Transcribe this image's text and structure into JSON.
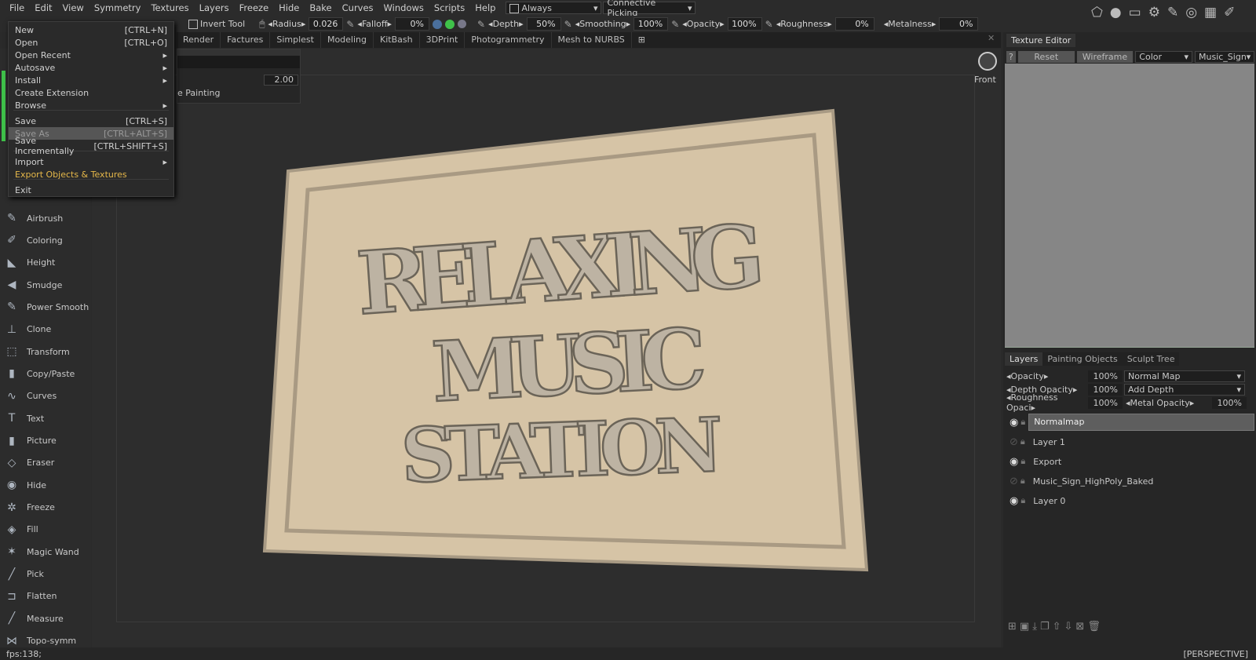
{
  "menubar": {
    "items": [
      "File",
      "Edit",
      "View",
      "Symmetry",
      "Textures",
      "Layers",
      "Freeze",
      "Hide",
      "Bake",
      "Curves",
      "Windows",
      "Scripts",
      "Help"
    ],
    "always": "Always",
    "picking": "Connective Picking"
  },
  "toolbar": {
    "invert_tool": "Invert Tool",
    "radius_label": "Radius",
    "radius": "0.026",
    "falloff_label": "Falloff",
    "falloff": "0%",
    "depth_label": "Depth",
    "depth": "50%",
    "smoothing_label": "Smoothing",
    "smoothing": "100%",
    "opacity_label": "Opacity",
    "opacity": "100%",
    "roughness_label": "Roughness",
    "roughness": "0%",
    "metalness_label": "Metalness",
    "metalness": "0%"
  },
  "tabs": [
    "Render",
    "Factures",
    "Simplest",
    "Modeling",
    "KitBash",
    "3DPrint",
    "Photogrammetry",
    "Mesh to NURBS"
  ],
  "file_menu": [
    {
      "label": "New",
      "shortcut": "[CTRL+N]"
    },
    {
      "label": "Open",
      "shortcut": "[CTRL+O]"
    },
    {
      "label": "Open Recent",
      "shortcut": "▸"
    },
    {
      "label": "Autosave",
      "shortcut": "▸"
    },
    {
      "label": "Install",
      "shortcut": "▸"
    },
    {
      "label": "Create Extension",
      "shortcut": ""
    },
    {
      "label": "Browse",
      "shortcut": "▸"
    },
    {
      "label": "Save",
      "shortcut": "[CTRL+S]"
    },
    {
      "label": "Save As",
      "shortcut": "[CTRL+ALT+S]"
    },
    {
      "label": "Save Incrementally",
      "shortcut": "[CTRL+SHIFT+S]"
    },
    {
      "label": "Import",
      "shortcut": "▸"
    },
    {
      "label": "Export Objects & Textures",
      "shortcut": ""
    },
    {
      "label": "Exit",
      "shortcut": ""
    }
  ],
  "tool_options": {
    "value": "2.00",
    "painting": "e Painting"
  },
  "tools": [
    {
      "label": "Airbrush",
      "icon": "airbrush-icon",
      "g": "✎"
    },
    {
      "label": "Coloring",
      "icon": "coloring-icon",
      "g": "✐"
    },
    {
      "label": "Height",
      "icon": "height-icon",
      "g": "◣"
    },
    {
      "label": "Smudge",
      "icon": "smudge-icon",
      "g": "◀"
    },
    {
      "label": "Power Smooth",
      "icon": "power-smooth-icon",
      "g": "✎"
    },
    {
      "label": "Clone",
      "icon": "clone-icon",
      "g": "⊥"
    },
    {
      "label": "Transform",
      "icon": "transform-icon",
      "g": "⬚"
    },
    {
      "label": "Copy/Paste",
      "icon": "copy-paste-icon",
      "g": "▮"
    },
    {
      "label": "Curves",
      "icon": "curves-icon",
      "g": "∿"
    },
    {
      "label": "Text",
      "icon": "text-icon",
      "g": "T"
    },
    {
      "label": "Picture",
      "icon": "picture-icon",
      "g": "▮"
    },
    {
      "label": "Eraser",
      "icon": "eraser-icon",
      "g": "◇"
    },
    {
      "label": "Hide",
      "icon": "eye-icon",
      "g": "◉"
    },
    {
      "label": "Freeze",
      "icon": "snowflake-icon",
      "g": "✲"
    },
    {
      "label": "Fill",
      "icon": "fill-icon",
      "g": "◈"
    },
    {
      "label": "Magic Wand",
      "icon": "magic-wand-icon",
      "g": "✶"
    },
    {
      "label": "Pick",
      "icon": "pick-icon",
      "g": "╱"
    },
    {
      "label": "Flatten",
      "icon": "flatten-icon",
      "g": "⊐"
    },
    {
      "label": "Measure",
      "icon": "measure-icon",
      "g": "╱"
    },
    {
      "label": "Topo-symm",
      "icon": "butterfly-icon",
      "g": "⋈"
    }
  ],
  "viewport": {
    "view_label": "Front",
    "sign_lines": [
      "RELAXING",
      "MUSIC",
      "STATION"
    ],
    "sign_color": "#d6c4a6"
  },
  "texture_editor": {
    "title": "Texture Editor",
    "help": "?",
    "reset": "Reset",
    "wireframe": "Wireframe",
    "channel": "Color",
    "object": "Music_Sign"
  },
  "layers_panel": {
    "tabs": [
      "Layers",
      "Painting Objects",
      "Sculpt Tree"
    ],
    "opacity_label": "Opacity",
    "opacity": "100%",
    "blend": "Normal Map",
    "depth_opacity_label": "Depth Opacity",
    "depth_opacity": "100%",
    "depth_mode": "Add Depth",
    "roughness_opacity_label": "Roughness Opaci",
    "roughness_opacity": "100%",
    "metal_opacity_label": "Metal Opacity",
    "metal_opacity": "100%",
    "layers": [
      {
        "name": "Normalmap",
        "visible": true
      },
      {
        "name": "Layer 1",
        "visible": false
      },
      {
        "name": "Export",
        "visible": true
      },
      {
        "name": "Music_Sign_HighPoly_Baked",
        "visible": false
      },
      {
        "name": "Layer 0",
        "visible": true
      }
    ]
  },
  "status": {
    "fps": "fps:138;",
    "projection": "[PERSPECTIVE]"
  },
  "colors": {
    "accent_green": "#3fc14a",
    "highlight": "#e6b84a"
  }
}
